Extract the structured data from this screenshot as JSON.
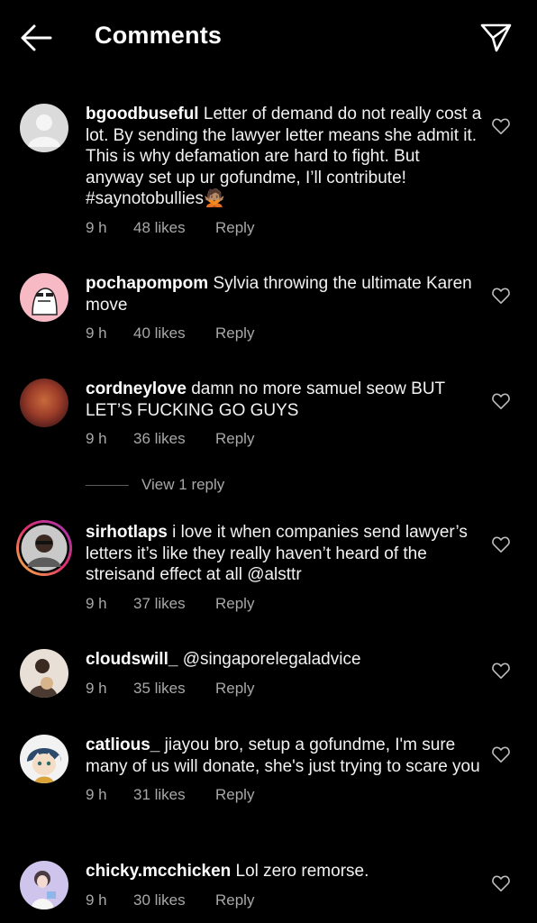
{
  "header": {
    "title": "Comments"
  },
  "comments": [
    {
      "username": "bgoodbuseful",
      "text": "Letter of demand do not really cost a lot. By sending the lawyer letter means she admit it. This is why defamation are hard to fight. But anyway set up ur gofundme, I’ll contribute! #saynotobullies🙅🏽",
      "time": "9 h",
      "likes": "48 likes",
      "reply": "Reply"
    },
    {
      "username": "pochapompom",
      "text": "Sylvia throwing the ultimate Karen move",
      "time": "9 h",
      "likes": "40 likes",
      "reply": "Reply"
    },
    {
      "username": "cordneylove",
      "text": "damn no more samuel seow BUT LET’S FUCKING GO GUYS",
      "time": "9 h",
      "likes": "36 likes",
      "reply": "Reply",
      "view_replies": "View 1 reply"
    },
    {
      "username": "sirhotlaps",
      "text": "i love it when companies send lawyer’s letters it’s like they really haven’t heard of the streisand effect at all @alsttr",
      "time": "9 h",
      "likes": "37 likes",
      "reply": "Reply"
    },
    {
      "username": "cloudswill_",
      "text": "@singaporelegaladvice",
      "time": "9 h",
      "likes": "35 likes",
      "reply": "Reply"
    },
    {
      "username": "catlious_",
      "text": "jiayou bro, setup a gofundme, I'm sure many of us will donate, she's just trying to scare you",
      "time": "9 h",
      "likes": "31 likes",
      "reply": "Reply"
    },
    {
      "username": "chicky.mcchicken",
      "text": "Lol zero remorse.",
      "time": "9 h",
      "likes": "30 likes",
      "reply": "Reply"
    }
  ],
  "icons": {
    "back": "arrow-left-icon",
    "send": "paper-plane-icon",
    "like": "heart-outline-icon"
  },
  "colors": {
    "background": "#000000",
    "text": "#ffffff",
    "secondary_text": "#a8a8a8",
    "story_ring": "#e1306c"
  }
}
